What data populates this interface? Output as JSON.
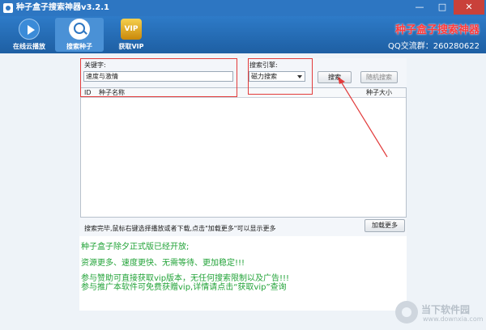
{
  "window": {
    "title": "种子盒子搜索神器v3.2.1",
    "controls": {
      "minimize": "—",
      "maximize": "□",
      "close": "✕"
    }
  },
  "toolbar": {
    "items": [
      {
        "label": "在线云播放",
        "icon": "play-icon"
      },
      {
        "label": "搜索种子",
        "icon": "search-icon"
      },
      {
        "label": "获取VIP",
        "icon": "vip-icon",
        "icon_text": "VIP"
      }
    ]
  },
  "brand": {
    "title": "种子盒子搜索神器",
    "qq_group": "QQ交流群：260280622",
    "title_color": "#ff3b3b"
  },
  "search": {
    "keyword_label": "关键字:",
    "keyword_value": "速度与激情",
    "engine_label": "搜索引擎:",
    "engine_selected": "磁力搜索",
    "search_button": "搜索",
    "random_button": "随机搜索"
  },
  "results": {
    "columns": [
      "ID",
      "种子名称",
      "种子大小"
    ],
    "rows": []
  },
  "status": {
    "text": "搜索完毕,鼠标右键选择播放或者下载,点击\"加载更多\"可以显示更多",
    "load_more_button": "加载更多"
  },
  "notices": [
    "种子盒子除夕正式版已经开放;",
    "资源更多、速度更快、无需等待、更加稳定!!!",
    "参与赞助可直接获取vip版本，无任何搜索限制以及广告!!!",
    "参与推广本软件可免费获赠vip,详情请点击“获取vip”查询"
  ],
  "notice_color": "#22a338",
  "watermark": {
    "text": "当下软件园",
    "url": "www.downxia.com"
  },
  "accent_color": "#2d76c2",
  "annotation_color": "#e23b3b"
}
